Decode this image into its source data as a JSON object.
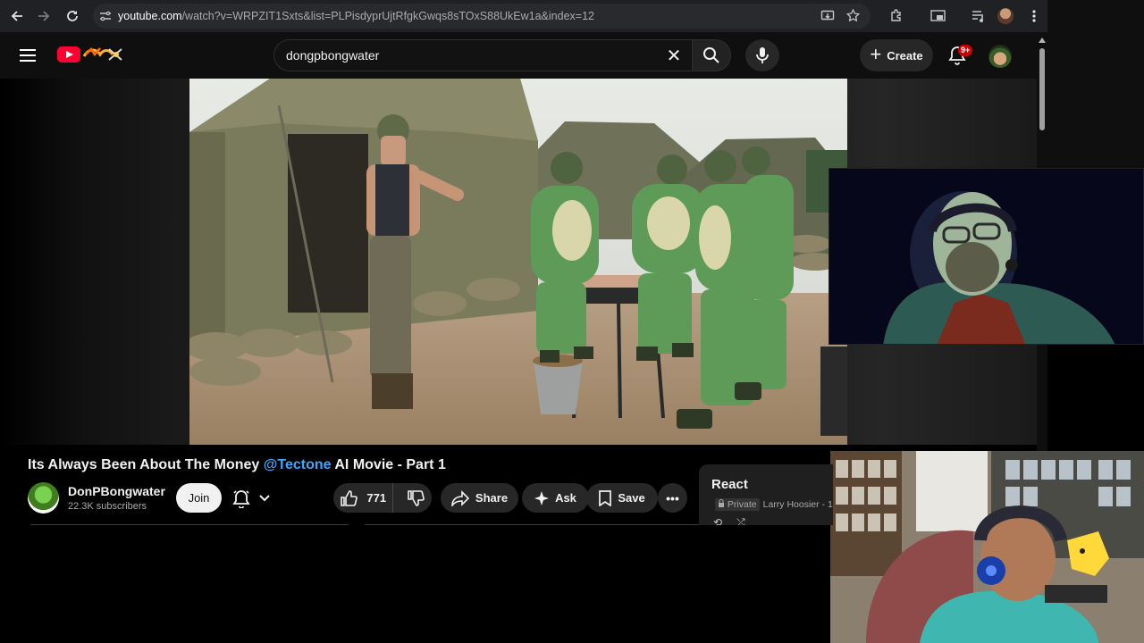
{
  "browser": {
    "url_host": "youtube.com",
    "url_path": "/watch?v=WRPZIT1Sxts&list=PLPisdyprUjtRfgkGwqs8sTOxS88UkEw1a&index=12",
    "nav_icons": [
      "back-icon",
      "forward-icon",
      "reload-icon"
    ],
    "right_icons": [
      "install-icon",
      "bookmark-star-icon",
      "extensions-icon",
      "tab-search-icon",
      "media-icon",
      "profile-icon",
      "menu-icon"
    ]
  },
  "header": {
    "search_query": "dongpbongwater",
    "create_label": "Create",
    "notif_count": "9+"
  },
  "video": {
    "title_prefix": "Its Always Been About The Money",
    "title_mention": "@Tectone",
    "title_suffix": "AI Movie - Part 1"
  },
  "channel": {
    "name": "DonPBongwater",
    "subscribers": "22.3K subscribers",
    "join_label": "Join"
  },
  "actions": {
    "like_count": "771",
    "share_label": "Share",
    "ask_label": "Ask",
    "save_label": "Save",
    "more_label": "•••"
  },
  "react": {
    "title": "React",
    "privacy": "Private",
    "owner": "Larry Hoosier - 1"
  },
  "colors": {
    "background": "#0f0f0f",
    "brand_red": "#ff0033",
    "mention_blue": "#3ea6ff",
    "pill_bg": "#272727"
  }
}
